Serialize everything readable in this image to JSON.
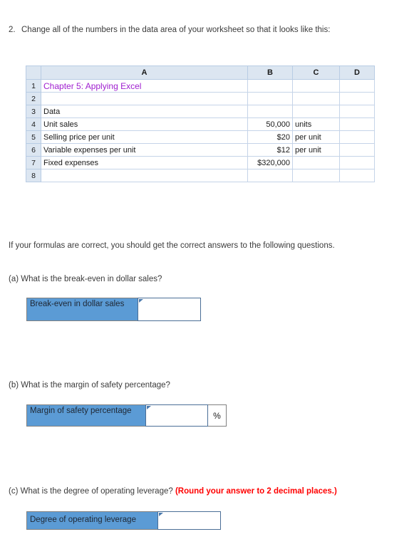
{
  "question2": {
    "number": "2.",
    "text": "Change all of the numbers in the data area of your worksheet so that it looks like this:"
  },
  "spreadsheet": {
    "column_headers": [
      "A",
      "B",
      "C",
      "D"
    ],
    "row_numbers": [
      "1",
      "2",
      "3",
      "4",
      "5",
      "6",
      "7",
      "8"
    ],
    "rows": [
      {
        "num": "1",
        "a": "Chapter 5: Applying Excel",
        "b": "",
        "c": "",
        "d": ""
      },
      {
        "num": "2",
        "a": "",
        "b": "",
        "c": "",
        "d": ""
      },
      {
        "num": "3",
        "a": "Data",
        "b": "",
        "c": "",
        "d": ""
      },
      {
        "num": "4",
        "a": "Unit sales",
        "b": "50,000",
        "c": "units",
        "d": ""
      },
      {
        "num": "5",
        "a": "Selling price per unit",
        "b": "$20",
        "c": "per unit",
        "d": ""
      },
      {
        "num": "6",
        "a": "Variable expenses per unit",
        "b": "$12",
        "c": "per unit",
        "d": ""
      },
      {
        "num": "7",
        "a": "Fixed expenses",
        "b": "$320,000",
        "c": "",
        "d": ""
      },
      {
        "num": "8",
        "a": "",
        "b": "",
        "c": "",
        "d": ""
      }
    ],
    "title_color": "#a020d0",
    "header_bg": "#dce6f1"
  },
  "formulas_note": "If your formulas are correct, you should get the correct answers to the following questions.",
  "questions": {
    "a": {
      "prompt": "(a) What is the break-even in dollar sales?",
      "label": "Break-even in dollar sales",
      "value": "",
      "suffix": ""
    },
    "b": {
      "prompt": "(b) What is the margin of safety percentage?",
      "label": "Margin of safety percentage",
      "value": "",
      "suffix": "%"
    },
    "c": {
      "prompt": "(c) What is the degree of operating leverage? ",
      "red_note": "(Round your answer to 2 decimal places.)",
      "label": "Degree of operating leverage",
      "value": "",
      "suffix": ""
    }
  },
  "colors": {
    "accent_blue": "#5b9bd5",
    "red": "#ff0000",
    "purple": "#a020d0"
  }
}
